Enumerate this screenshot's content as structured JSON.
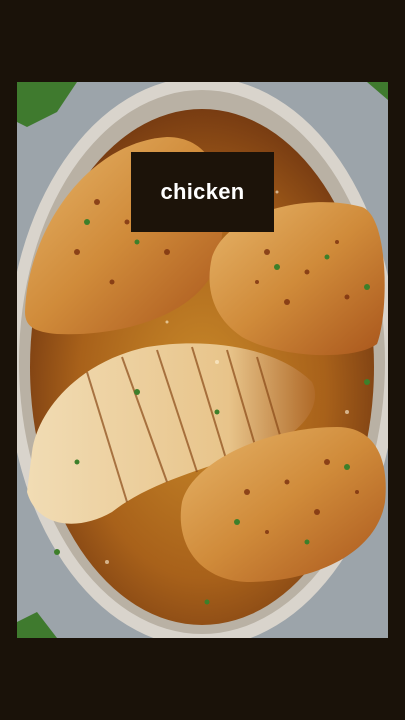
{
  "caption": {
    "text": "chicken"
  },
  "photo": {
    "subject": "pan-seared-chicken-in-skillet-image"
  },
  "colors": {
    "background": "#1a1209",
    "caption_box": "#1c1309",
    "caption_text": "#ffffff"
  }
}
